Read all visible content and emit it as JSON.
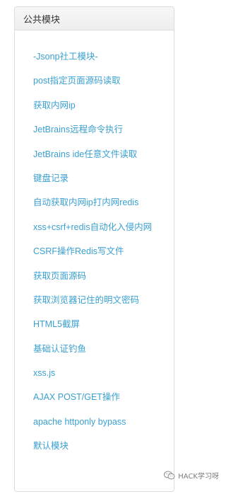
{
  "panel": {
    "title": "公共模块",
    "items": [
      {
        "label": "-Jsonp社工模块-"
      },
      {
        "label": "post指定页面源码读取"
      },
      {
        "label": "获取内网ip"
      },
      {
        "label": "JetBrains远程命令执行"
      },
      {
        "label": "JetBrains ide任意文件读取"
      },
      {
        "label": "键盘记录"
      },
      {
        "label": "自动获取内网ip打内网redis"
      },
      {
        "label": "xss+csrf+redis自动化入侵内网"
      },
      {
        "label": "CSRF操作Redis写文件"
      },
      {
        "label": "获取页面源码"
      },
      {
        "label": "获取浏览器记住的明文密码"
      },
      {
        "label": "HTML5截屏"
      },
      {
        "label": "基础认证钓鱼"
      },
      {
        "label": "xss.js"
      },
      {
        "label": "AJAX POST/GET操作"
      },
      {
        "label": "apache httponly bypass"
      },
      {
        "label": "默认模块"
      }
    ]
  },
  "watermark": {
    "icon": "wechat-icon",
    "text": "HACK学习呀"
  },
  "colors": {
    "link": "#3aa0d0",
    "header_bg": "#eeeeee",
    "border": "#d9dde1"
  }
}
